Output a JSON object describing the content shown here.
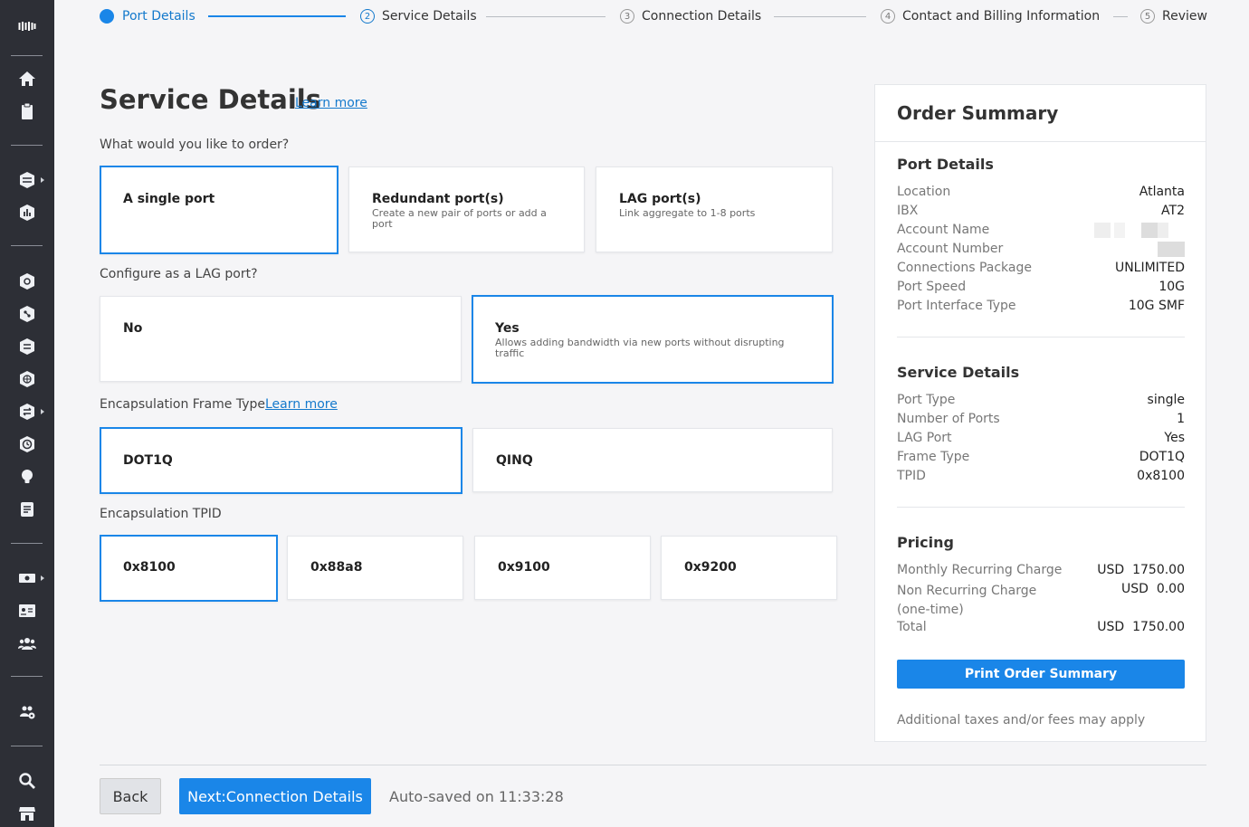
{
  "stepper": {
    "steps": [
      {
        "num": "",
        "label": "Port Details"
      },
      {
        "num": "2",
        "label": "Service Details"
      },
      {
        "num": "3",
        "label": "Connection Details"
      },
      {
        "num": "4",
        "label": "Contact and Billing Information"
      },
      {
        "num": "5",
        "label": "Review"
      }
    ]
  },
  "main": {
    "title": "Service Details",
    "title_learn_more": "Learn more",
    "order_question": "What would you like to order?",
    "order_options": [
      {
        "title": "A single port",
        "subtitle": ""
      },
      {
        "title": "Redundant port(s)",
        "subtitle": "Create a new pair of ports or add a port"
      },
      {
        "title": "LAG port(s)",
        "subtitle": "Link aggregate to 1-8 ports"
      }
    ],
    "lag_question": "Configure as a LAG port?",
    "lag_options": [
      {
        "title": "No",
        "subtitle": ""
      },
      {
        "title": "Yes",
        "subtitle": "Allows adding bandwidth via new ports without disrupting traffic"
      }
    ],
    "frame_label": "Encapsulation Frame Type",
    "frame_learn_more": "Learn more",
    "frame_options": [
      "DOT1Q",
      "QINQ"
    ],
    "tpid_label": "Encapsulation TPID",
    "tpid_options": [
      "0x8100",
      "0x88a8",
      "0x9100",
      "0x9200"
    ]
  },
  "summary": {
    "title": "Order Summary",
    "port_details": {
      "title": "Port Details",
      "rows": [
        {
          "k": "Location",
          "v": "Atlanta"
        },
        {
          "k": "IBX",
          "v": "AT2"
        },
        {
          "k": "Account Name",
          "v": ""
        },
        {
          "k": "Account Number",
          "v": ""
        },
        {
          "k": "Connections Package",
          "v": "UNLIMITED"
        },
        {
          "k": "Port Speed",
          "v": "10G"
        },
        {
          "k": "Port Interface Type",
          "v": "10G SMF"
        }
      ]
    },
    "service_details": {
      "title": "Service Details",
      "rows": [
        {
          "k": "Port Type",
          "v": "single"
        },
        {
          "k": "Number of Ports",
          "v": "1"
        },
        {
          "k": "LAG Port",
          "v": "Yes"
        },
        {
          "k": "Frame Type",
          "v": "DOT1Q"
        },
        {
          "k": "TPID",
          "v": "0x8100"
        }
      ]
    },
    "pricing": {
      "title": "Pricing",
      "rows": [
        {
          "k": "Monthly Recurring Charge",
          "v": "USD  1750.00"
        },
        {
          "k": "Non Recurring Charge (one-time)",
          "v": "USD  0.00"
        },
        {
          "k": "Total",
          "v": "USD  1750.00"
        }
      ]
    },
    "print_button": "Print Order Summary",
    "note": "Additional taxes and/or fees may apply"
  },
  "footer": {
    "back": "Back",
    "next": "Next:Connection Details",
    "autosave": "Auto-saved on 11:33:28"
  },
  "colors": {
    "accent": "#1a86e8",
    "sidebar": "#2d2f36"
  },
  "sidebar_icons": [
    "logo-icon",
    "home-icon",
    "clipboard-icon",
    "layers-icon",
    "chart-icon",
    "hexagon-network-icon",
    "share-icon",
    "stack-icon",
    "globe-icon",
    "exchange-icon",
    "clock-icon",
    "lightbulb-icon",
    "document-icon",
    "money-icon",
    "id-card-icon",
    "users-icon",
    "team-settings-icon",
    "search-icon",
    "store-icon"
  ]
}
